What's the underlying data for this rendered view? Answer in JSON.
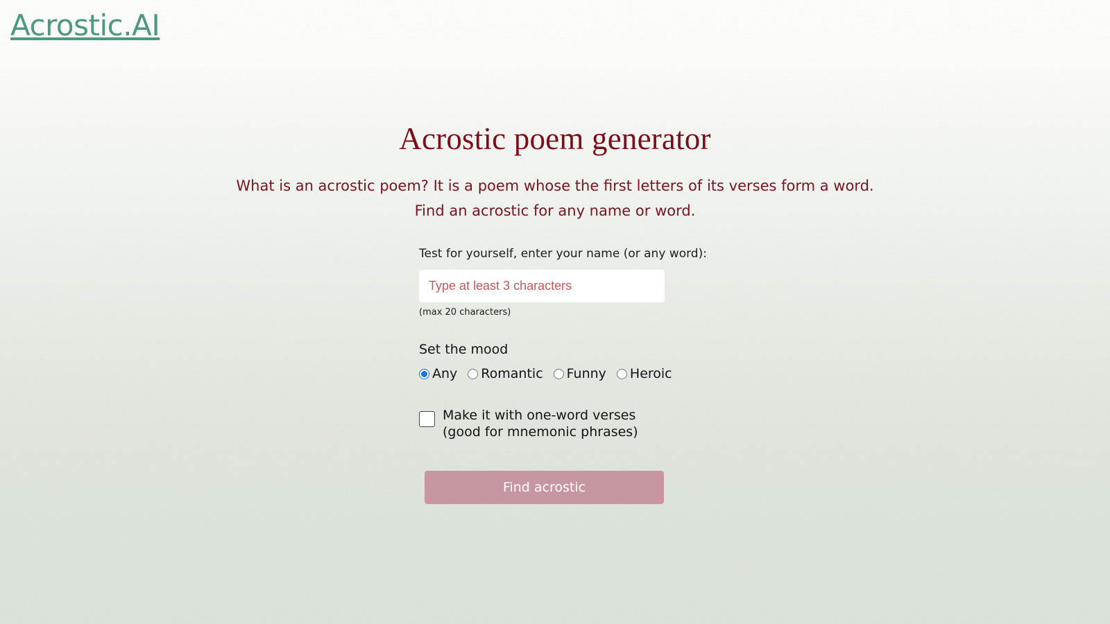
{
  "brand": {
    "logo_text": "Acrostic.AI",
    "logo_color": "#4d9980"
  },
  "hero": {
    "title": "Acrostic poem generator",
    "title_color": "#7d0d1a",
    "description_line1": "What is an acrostic poem? It is a poem whose the first letters of its verses form a word.",
    "description_line2": "Find an acrostic for any name or word."
  },
  "form": {
    "input_label": "Test for yourself, enter your name (or any word):",
    "input_value": "",
    "input_placeholder": "Type at least 3 characters",
    "input_placeholder_color": "#cb5555",
    "max_note": "(max 20 characters)",
    "mood_title": "Set the mood",
    "mood_options": [
      {
        "label": "Any",
        "selected": true
      },
      {
        "label": "Romantic",
        "selected": false
      },
      {
        "label": "Funny",
        "selected": false
      },
      {
        "label": "Heroic",
        "selected": false
      }
    ],
    "checkbox": {
      "checked": false,
      "label_line1": "Make it with one-word verses",
      "label_line2": "(good for mnemonic phrases)"
    },
    "submit_label": "Find acrostic",
    "submit_color": "#c896a0"
  },
  "theme": {
    "background_top": "#fcfcfb",
    "background_bottom": "#dbe2d9"
  }
}
